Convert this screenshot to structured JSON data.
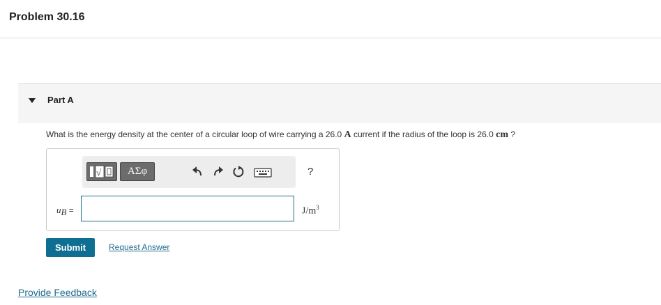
{
  "header": {
    "title": "Problem 30.16"
  },
  "part": {
    "label": "Part A"
  },
  "question": {
    "text_before_current": "What is the energy density at the center of a circular loop of wire carrying a 26.0 ",
    "current_unit": "A",
    "text_before_radius_unit": " current if the radius of the loop is 26.0 ",
    "radius_unit": "cm",
    "text_end": " ?"
  },
  "toolbar": {
    "greek_label": "ΑΣφ",
    "help_label": "?",
    "icons": [
      "templates-icon",
      "greek-symbols-icon",
      "undo-icon",
      "redo-icon",
      "reset-icon",
      "keyboard-icon",
      "help-icon"
    ]
  },
  "answer": {
    "variable": "u",
    "variable_sub": "B",
    "equals": " =",
    "value": "",
    "unit_base": "J/m",
    "unit_exp": "3"
  },
  "actions": {
    "submit_label": "Submit",
    "request_answer_label": "Request Answer",
    "feedback_label": "Provide Feedback"
  },
  "colors": {
    "accent": "#0e6f93",
    "link": "#1f6b8f",
    "part_bar": "#f5f5f5"
  }
}
